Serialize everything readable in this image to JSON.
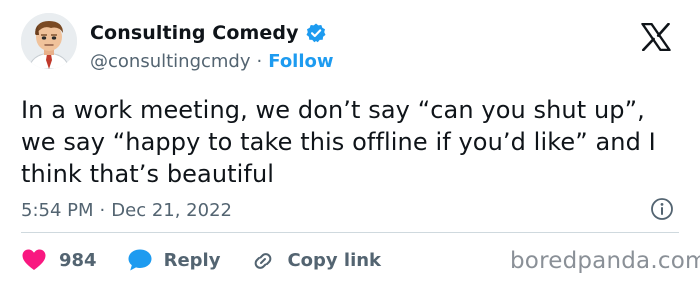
{
  "author": {
    "display_name": "Consulting Comedy",
    "handle": "@consultingcmdy",
    "separator": "·",
    "follow_label": "Follow",
    "verified": true
  },
  "tweet": {
    "text": "In a work meeting, we don’t say “can you shut up”, we say “happy to take this offline if you’d like” and I think that’s beautiful",
    "time": "5:54 PM",
    "date": "Dec 21, 2022",
    "separator": "·"
  },
  "actions": {
    "like_count": "984",
    "reply_label": "Reply",
    "copy_link_label": "Copy link"
  },
  "icons": {
    "logo": "x-logo-icon",
    "verified": "verified-badge-icon",
    "info": "info-icon",
    "like": "heart-icon",
    "reply": "speech-bubble-icon",
    "copy": "link-icon"
  },
  "colors": {
    "accent": "#1d9bf0",
    "like": "#f91880",
    "muted_text": "#536471",
    "text": "#0f1419"
  },
  "watermark": "boredpanda.com"
}
